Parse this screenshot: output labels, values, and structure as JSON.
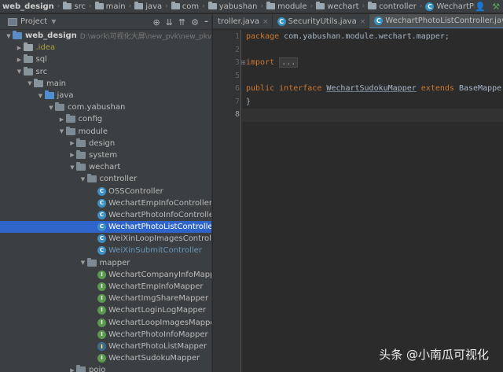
{
  "breadcrumb": [
    "web_design",
    "src",
    "main",
    "java",
    "com",
    "yabushan",
    "module",
    "wechart",
    "controller",
    "WechartPhotoListController"
  ],
  "project_panel": {
    "title": "Project",
    "dropdown_icon": "caret-down-icon",
    "tools": [
      "crosshair-icon",
      "collapse-icon",
      "expand-icon",
      "gear-icon",
      "hide-icon"
    ]
  },
  "tree": [
    {
      "label": "web_design",
      "path": "D:\\work\\可视化大屏\\new_pvk\\new_pkvie",
      "type": "module-folder",
      "expanded": true
    },
    {
      "label": ".idea",
      "type": "idea-folder",
      "expanded": false
    },
    {
      "label": "sql",
      "type": "folder",
      "expanded": false
    },
    {
      "label": "src",
      "type": "folder",
      "expanded": true
    },
    {
      "label": "main",
      "type": "folder",
      "expanded": true
    },
    {
      "label": "java",
      "type": "source-folder",
      "expanded": true
    },
    {
      "label": "com.yabushan",
      "type": "package",
      "expanded": true
    },
    {
      "label": "config",
      "type": "package",
      "expanded": false
    },
    {
      "label": "module",
      "type": "package",
      "expanded": true
    },
    {
      "label": "design",
      "type": "package",
      "expanded": false
    },
    {
      "label": "system",
      "type": "package",
      "expanded": false
    },
    {
      "label": "wechart",
      "type": "package",
      "expanded": true
    },
    {
      "label": "controller",
      "type": "package",
      "expanded": true
    },
    {
      "label": "OSSController",
      "type": "class"
    },
    {
      "label": "WechartEmpInfoController",
      "type": "class"
    },
    {
      "label": "WechartPhotoInfoController",
      "type": "class"
    },
    {
      "label": "WechartPhotoListController",
      "type": "class",
      "selected": true
    },
    {
      "label": "WeiXinLoopImagesController",
      "type": "class"
    },
    {
      "label": "WeiXinSubmitController",
      "type": "class",
      "modified": true
    },
    {
      "label": "mapper",
      "type": "package",
      "expanded": true
    },
    {
      "label": "WechartCompanyInfoMapper",
      "type": "interface"
    },
    {
      "label": "WechartEmpInfoMapper",
      "type": "interface"
    },
    {
      "label": "WechartImgShareMapper",
      "type": "interface"
    },
    {
      "label": "WechartLoginLogMapper",
      "type": "interface"
    },
    {
      "label": "WechartLoopImagesMapper",
      "type": "interface"
    },
    {
      "label": "WechartPhotoInfoMapper",
      "type": "interface"
    },
    {
      "label": "WechartPhotoListMapper",
      "type": "interface",
      "alt": true
    },
    {
      "label": "WechartSudokuMapper",
      "type": "interface"
    },
    {
      "label": "pojo",
      "type": "package",
      "expanded": false
    }
  ],
  "tabs": [
    {
      "label": "troller.java",
      "icon": "class-icon"
    },
    {
      "label": "SecurityUtils.java",
      "icon": "class-icon"
    },
    {
      "label": "WechartPhotoListController.java",
      "icon": "class-icon",
      "active": true
    }
  ],
  "editor": {
    "line_numbers": [
      "1",
      "2",
      "3",
      "5",
      "6",
      "7",
      "8"
    ],
    "lines": [
      {
        "n": "1",
        "tokens": [
          {
            "t": "package ",
            "c": "kw"
          },
          {
            "t": "com.yabushan.module.wechart.mapper;",
            "c": ""
          }
        ]
      },
      {
        "n": "2",
        "tokens": []
      },
      {
        "n": "3",
        "tokens": [
          {
            "t": "import ",
            "c": "kw"
          },
          {
            "t": "...",
            "c": "folded"
          }
        ]
      },
      {
        "n": "5",
        "tokens": []
      },
      {
        "n": "6",
        "tokens": [
          {
            "t": "public ",
            "c": "kw"
          },
          {
            "t": "interface ",
            "c": "kw"
          },
          {
            "t": "WechartSudokuMapper",
            "c": "iface"
          },
          {
            "t": " ",
            "c": ""
          },
          {
            "t": "extends ",
            "c": "kw"
          },
          {
            "t": "BaseMappe",
            "c": ""
          }
        ]
      },
      {
        "n": "7",
        "tokens": [
          {
            "t": "}",
            "c": ""
          }
        ]
      },
      {
        "n": "8",
        "tokens": [],
        "current": true
      }
    ]
  },
  "watermark": "头条 @小南瓜可视化",
  "colors": {
    "keyword": "#cc7832",
    "selection": "#2f65ca",
    "class_icon": "#3d8fc5",
    "interface_icon": "#5b9a4f"
  }
}
